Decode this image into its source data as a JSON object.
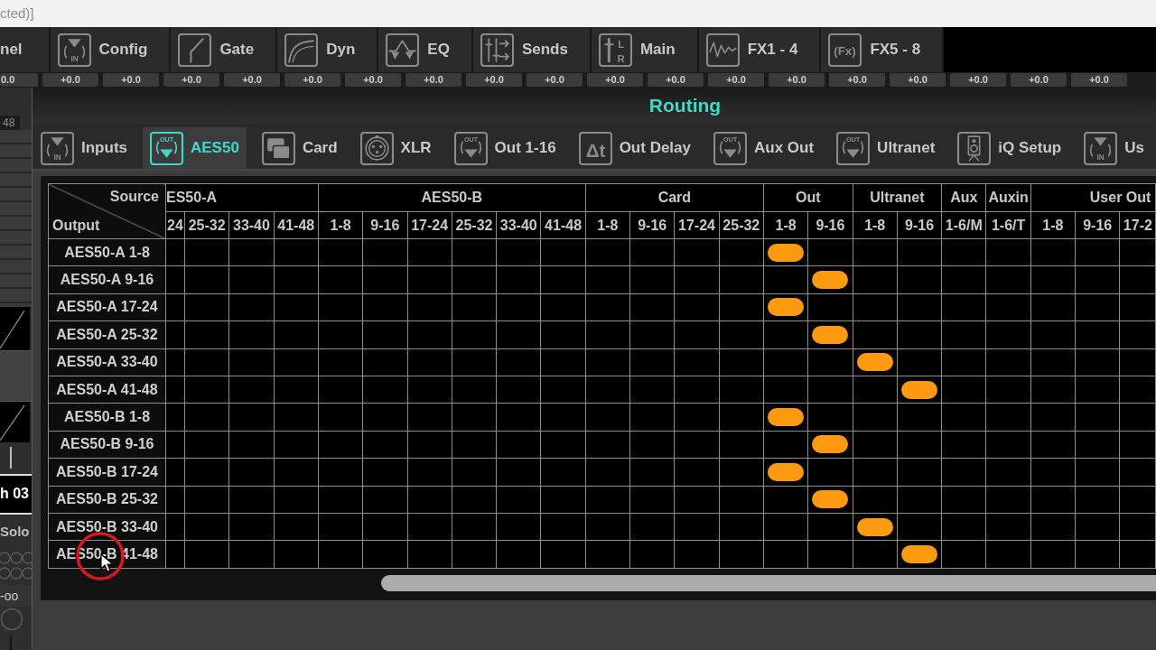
{
  "window_title": "cted)]",
  "section_tabs": [
    {
      "label": "nel"
    },
    {
      "label": "Config",
      "icon_text": [
        "IN"
      ]
    },
    {
      "label": "Gate"
    },
    {
      "label": "Dyn"
    },
    {
      "label": "EQ"
    },
    {
      "label": "Sends"
    },
    {
      "label": "Main",
      "icon_text": [
        "L",
        "R"
      ]
    },
    {
      "label": "FX1 - 4"
    },
    {
      "label": "FX5 - 8",
      "icon_text": [
        "(Fx)"
      ]
    }
  ],
  "gain_buttons": [
    "0.0",
    "+0.0",
    "+0.0",
    "+0.0",
    "+0.0",
    "+0.0",
    "+0.0",
    "+0.0",
    "+0.0",
    "+0.0",
    "+0.0",
    "+0.0",
    "+0.0",
    "+0.0",
    "+0.0",
    "+0.0",
    "+0.0",
    "+0.0",
    "+0.0"
  ],
  "channel_strip": {
    "scale_label": "48",
    "channel_name": "h 03",
    "solo_label": "Solo",
    "level_readout": "-oo"
  },
  "routing_window": {
    "title": "Routing",
    "tabs": [
      {
        "label": "Inputs",
        "icon_text": [
          "IN"
        ],
        "selected": false
      },
      {
        "label": "AES50",
        "icon_text": [
          "OUT"
        ],
        "selected": true
      },
      {
        "label": "Card",
        "selected": false
      },
      {
        "label": "XLR",
        "selected": false
      },
      {
        "label": "Out 1-16",
        "icon_text": [
          "OUT"
        ],
        "selected": false
      },
      {
        "label": "Out Delay",
        "icon_text": [
          "Δt"
        ],
        "selected": false
      },
      {
        "label": "Aux Out",
        "icon_text": [
          "OUT"
        ],
        "selected": false
      },
      {
        "label": "Ultranet",
        "icon_text": [
          "OUT"
        ],
        "selected": false
      },
      {
        "label": "iQ Setup",
        "selected": false
      },
      {
        "label": "Us",
        "icon_text": [
          "IN"
        ],
        "selected": false
      }
    ],
    "matrix": {
      "source_label": "Source",
      "output_label": "Output",
      "groups": [
        {
          "label": "ES50-A",
          "columns": [
            "24",
            "25-32",
            "33-40",
            "41-48"
          ]
        },
        {
          "label": "AES50-B",
          "columns": [
            "1-8",
            "9-16",
            "17-24",
            "25-32",
            "33-40",
            "41-48"
          ]
        },
        {
          "label": "Card",
          "columns": [
            "1-8",
            "9-16",
            "17-24",
            "25-32"
          ]
        },
        {
          "label": "Out",
          "columns": [
            "1-8",
            "9-16"
          ]
        },
        {
          "label": "Ultranet",
          "columns": [
            "1-8",
            "9-16"
          ]
        },
        {
          "label": "Aux",
          "columns": [
            "1-6/M"
          ]
        },
        {
          "label": "Auxin",
          "columns": [
            "1-6/T"
          ]
        },
        {
          "label": "User Out",
          "columns": [
            "1-8",
            "9-16",
            "17-2"
          ]
        }
      ],
      "rows": [
        {
          "label": "AES50-A 1-8",
          "cells": [
            false,
            false,
            false,
            false,
            false,
            false,
            false,
            false,
            false,
            false,
            false,
            false,
            false,
            false,
            true,
            false,
            false,
            false,
            false,
            false,
            false,
            false,
            false
          ]
        },
        {
          "label": "AES50-A 9-16",
          "cells": [
            false,
            false,
            false,
            false,
            false,
            false,
            false,
            false,
            false,
            false,
            false,
            false,
            false,
            false,
            false,
            true,
            false,
            false,
            false,
            false,
            false,
            false,
            false
          ]
        },
        {
          "label": "AES50-A 17-24",
          "cells": [
            false,
            false,
            false,
            false,
            false,
            false,
            false,
            false,
            false,
            false,
            false,
            false,
            false,
            false,
            true,
            false,
            false,
            false,
            false,
            false,
            false,
            false,
            false
          ]
        },
        {
          "label": "AES50-A 25-32",
          "cells": [
            false,
            false,
            false,
            false,
            false,
            false,
            false,
            false,
            false,
            false,
            false,
            false,
            false,
            false,
            false,
            true,
            false,
            false,
            false,
            false,
            false,
            false,
            false
          ]
        },
        {
          "label": "AES50-A 33-40",
          "cells": [
            false,
            false,
            false,
            false,
            false,
            false,
            false,
            false,
            false,
            false,
            false,
            false,
            false,
            false,
            false,
            false,
            true,
            false,
            false,
            false,
            false,
            false,
            false
          ]
        },
        {
          "label": "AES50-A 41-48",
          "cells": [
            false,
            false,
            false,
            false,
            false,
            false,
            false,
            false,
            false,
            false,
            false,
            false,
            false,
            false,
            false,
            false,
            false,
            true,
            false,
            false,
            false,
            false,
            false
          ]
        },
        {
          "label": "AES50-B 1-8",
          "cells": [
            false,
            false,
            false,
            false,
            false,
            false,
            false,
            false,
            false,
            false,
            false,
            false,
            false,
            false,
            true,
            false,
            false,
            false,
            false,
            false,
            false,
            false,
            false
          ]
        },
        {
          "label": "AES50-B 9-16",
          "cells": [
            false,
            false,
            false,
            false,
            false,
            false,
            false,
            false,
            false,
            false,
            false,
            false,
            false,
            false,
            false,
            true,
            false,
            false,
            false,
            false,
            false,
            false,
            false
          ]
        },
        {
          "label": "AES50-B 17-24",
          "cells": [
            false,
            false,
            false,
            false,
            false,
            false,
            false,
            false,
            false,
            false,
            false,
            false,
            false,
            false,
            true,
            false,
            false,
            false,
            false,
            false,
            false,
            false,
            false
          ]
        },
        {
          "label": "AES50-B 25-32",
          "cells": [
            false,
            false,
            false,
            false,
            false,
            false,
            false,
            false,
            false,
            false,
            false,
            false,
            false,
            false,
            false,
            true,
            false,
            false,
            false,
            false,
            false,
            false,
            false
          ]
        },
        {
          "label": "AES50-B 33-40",
          "cells": [
            false,
            false,
            false,
            false,
            false,
            false,
            false,
            false,
            false,
            false,
            false,
            false,
            false,
            false,
            false,
            false,
            true,
            false,
            false,
            false,
            false,
            false,
            false
          ]
        },
        {
          "label": "AES50-B 41-48",
          "cells": [
            false,
            false,
            false,
            false,
            false,
            false,
            false,
            false,
            false,
            false,
            false,
            false,
            false,
            false,
            false,
            false,
            false,
            true,
            false,
            false,
            false,
            false,
            false
          ]
        }
      ]
    }
  }
}
